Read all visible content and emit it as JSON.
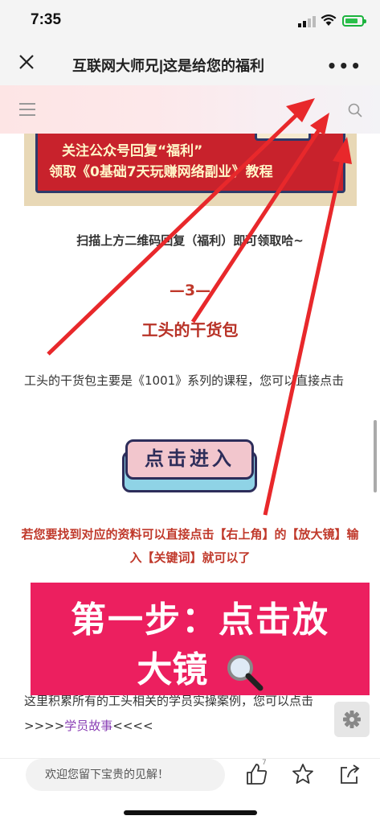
{
  "status_bar": {
    "time": "7:35"
  },
  "nav": {
    "title": "互联网大师兄|这是给您的福利",
    "more_label": "•••"
  },
  "banner": {
    "line1": "关注公众号回复“福利”",
    "line2": "领取《0基础7天玩赚网络副业》教程"
  },
  "article": {
    "scan_tip": "扫描上方二维码回复（福利）即可领取哈~",
    "section_number": "—3—",
    "section_title": "工头的干货包",
    "body": "工头的干货包主要是《1001》系列的课程，您可以直接点击",
    "enter_button": "点击进入",
    "red_tip": "若您要找到对应的资料可以直接点击【右上角】的【放大镜】输入【关键词】就可以了",
    "bottom_text_prefix": "这里积累所有的工头相关的学员实操案例，您可以点击",
    "bottom_text_arrows_left": ">>>>",
    "story_link": "学员故事",
    "bottom_text_arrows_right": "<<<<"
  },
  "overlay": {
    "line1": "第一步：点击放",
    "line2": "大镜"
  },
  "bottom_bar": {
    "comment_placeholder": "欢迎您留下宝贵的见解！",
    "like_count": "7"
  },
  "icons": [
    "close-icon",
    "more-icon",
    "menu-icon",
    "search-icon",
    "magnifier-icon",
    "gear-icon",
    "like-icon",
    "star-icon",
    "share-icon"
  ],
  "colors": {
    "accent_red": "#c0392b",
    "overlay_pink": "#ec1f5f",
    "link_purple": "#8a3fb5",
    "arrow_red": "#e8282b"
  }
}
